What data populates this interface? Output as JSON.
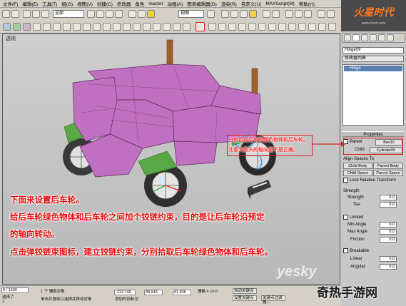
{
  "menubar": {
    "items": [
      "文件(F)",
      "编辑(E)",
      "工具(T)",
      "组(G)",
      "视图(V)",
      "创建(C)",
      "修改器",
      "角色",
      "reactor",
      "动画(A)",
      "图表编辑器(D)",
      "渲染(R)",
      "自定义(U)",
      "MAXScript(M)",
      "帮助(H)"
    ]
  },
  "toolbar": {
    "selection_filter": "全部",
    "reference_coord": "视图"
  },
  "viewport": {
    "label": "透视"
  },
  "logo": {
    "text": "火星时代",
    "url": "www.hxsd.com"
  },
  "command_panel": {
    "object_name": "Hinge09",
    "modifier_list": "修改器列表",
    "stack_item": "Hinge"
  },
  "properties": {
    "header": "Properties",
    "parent_label": "Parent",
    "parent_value": "Box10",
    "child_label": "Child",
    "child_value": "Cylinder05",
    "align_spaces": "Align Spaces To",
    "child_body": "Child Body",
    "parent_body": "Parent Body",
    "child_space": "Child Space",
    "parent_space": "Parent Space",
    "lock_relative": "Lock Relative Transform",
    "strength_header": "Strength",
    "strength_label": "Strength",
    "strength_value": "0.0",
    "tau_label": "Tau",
    "tau_value": "0.0",
    "limited_label": "Limited",
    "min_angle_label": "Min Angle",
    "min_angle_value": "0.0",
    "max_angle_label": "Max Angle",
    "max_angle_value": "0.0",
    "friction_label": "Friction",
    "friction_value": "0.0",
    "breakable_label": "Breakable",
    "linear_label": "Linear",
    "linear_value": "0.0",
    "angular_label": "Angular",
    "angular_value": "0.0"
  },
  "callout": {
    "line1": "分别拾取后车轮绿色物体和后车轮。",
    "line2": "注意大箭头的轴向是不是正确。"
  },
  "tutorial": {
    "line1": "下面来设置后车轮。",
    "line2": "给后车轮绿色物体和后车轮之间加个铰链约束，目的是让后车轮沿预定",
    "line3": "的轴向转动。",
    "line4": "点击弹铰链束图标，建立铰链约束，分别拾取后车轮绿色物体和后车轮。"
  },
  "statusbar": {
    "frame": "0 / 1500",
    "selected": "选择了 1",
    "helper": "1 个 辅助对象",
    "x": "-213.749",
    "y": "88.943",
    "z": "61.836",
    "grid": "栅格 = 10.0",
    "autokey": "自动关键点",
    "set_key": "设置关键点",
    "prompt": "单击并拖动以选择并移动对象",
    "add_time_tag": "添加时间标记",
    "key_filters": "关键点过滤器..."
  },
  "watermark": {
    "text": "奇热手游网",
    "yesky": "yesky"
  },
  "colors": {
    "callout_red": "#e02020",
    "tutorial_red": "#e81010",
    "car_body": "#c070c0",
    "car_green": "#5aa845"
  }
}
